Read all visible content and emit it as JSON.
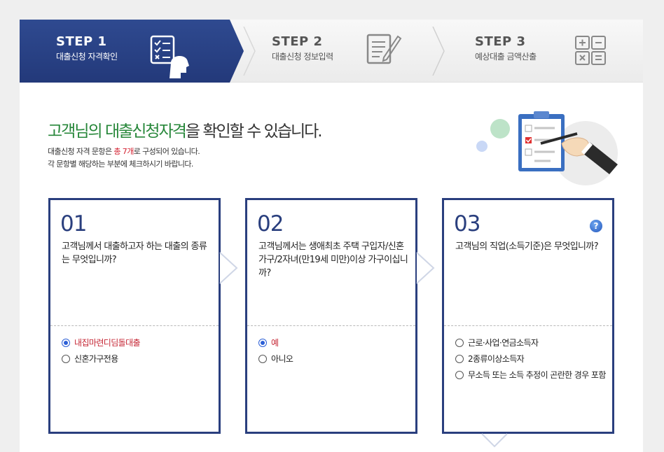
{
  "steps": [
    {
      "title": "STEP 1",
      "subtitle": "대출신청 자격확인",
      "active": true
    },
    {
      "title": "STEP 2",
      "subtitle": "대출신청 정보입력",
      "active": false
    },
    {
      "title": "STEP 3",
      "subtitle": "예상대출 금액산출",
      "active": false
    }
  ],
  "headline": {
    "part1": "고객님의 대출신청자격",
    "part2": "을 확인할 수 있습니다."
  },
  "description": {
    "line1_before": "대출신청 자격 문항은 ",
    "line1_highlight": "총 7개",
    "line1_after": "로 구성되어 있습니다.",
    "line2": "각 문항별 해당하는 부분에 체크하시기 바랍니다."
  },
  "cards": [
    {
      "num": "01",
      "question": "고객님께서 대출하고자 하는 대출의 종류는 무엇입니까?",
      "options": [
        {
          "label": "내집마련디딤돌대출",
          "selected": true
        },
        {
          "label": "신혼가구전용",
          "selected": false
        }
      ]
    },
    {
      "num": "02",
      "question": "고객님께서는 생애최초 주택 구입자/신혼가구/2자녀(만19세 미만)이상 가구이십니까?",
      "options": [
        {
          "label": "예",
          "selected": true
        },
        {
          "label": "아니오",
          "selected": false
        }
      ]
    },
    {
      "num": "03",
      "question": "고객님의 직업(소득기준)은 무엇입니까?",
      "help": "?",
      "options": [
        {
          "label": "근로·사업·연금소득자",
          "selected": false
        },
        {
          "label": "2종류이상소득자",
          "selected": false
        },
        {
          "label": "무소득 또는 소득 추정이 곤란한 경우 포함",
          "selected": false
        }
      ]
    }
  ],
  "icons": [
    "checklist-person-icon",
    "document-pencil-icon",
    "calculator-icon",
    "help-icon",
    "clipboard-hand-illustration"
  ],
  "colors": {
    "navy": "#2a3f7e",
    "green": "#27873a",
    "red": "#d3202f",
    "radio_blue": "#2c5fd6"
  }
}
